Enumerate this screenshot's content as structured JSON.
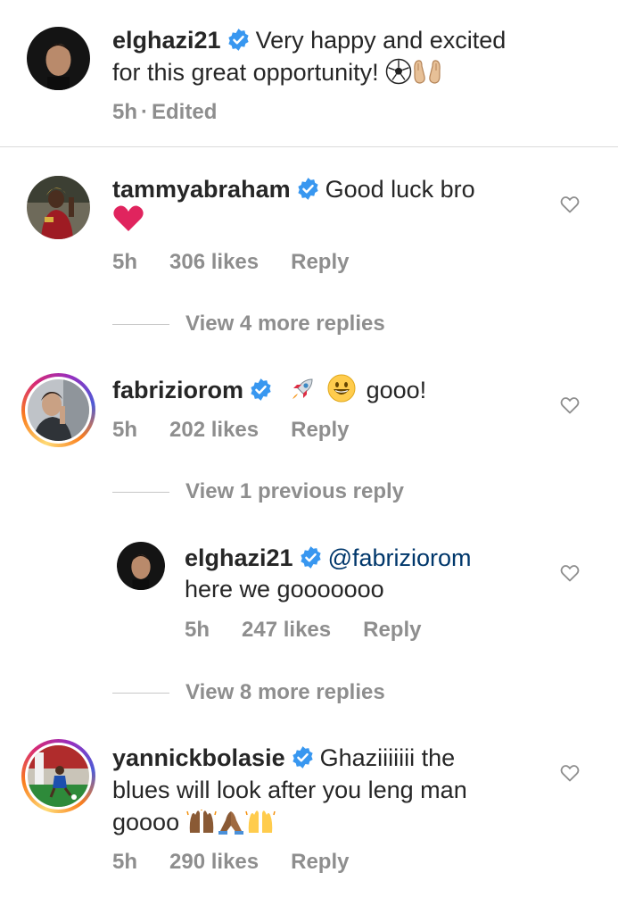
{
  "post": {
    "username": "elghazi21",
    "caption_line1": "Very happy and excited",
    "caption_line2": "for this great opportunity!",
    "time": "5h",
    "edited": "Edited",
    "separator": "·"
  },
  "comments": [
    {
      "username": "tammyabraham",
      "text": "Good luck bro",
      "time": "5h",
      "likes": "306 likes",
      "reply_label": "Reply",
      "view_replies": "View 4 more replies"
    },
    {
      "username": "fabriziorom",
      "text": "gooo!",
      "time": "5h",
      "likes": "202 likes",
      "reply_label": "Reply",
      "view_previous": "View 1 previous reply",
      "reply": {
        "username": "elghazi21",
        "mention": "@fabriziorom",
        "text": "here we gooooooo",
        "time": "5h",
        "likes": "247 likes",
        "reply_label": "Reply"
      },
      "view_replies": "View 8 more replies"
    },
    {
      "username": "yannickbolasie",
      "text_line1": "Ghaziiiiiii the",
      "text_line2": "blues will look after you leng man",
      "text_line3": "goooo",
      "time": "5h",
      "likes": "290 likes",
      "reply_label": "Reply"
    }
  ],
  "icons": {
    "verified": "verified-badge-icon",
    "heart": "heart-outline-icon",
    "emojis": [
      "soccer-ball",
      "palms-up-together",
      "red-heart",
      "rocket",
      "grinning-face",
      "raising-hands",
      "folded-hands"
    ]
  },
  "colors": {
    "text": "#262626",
    "secondary": "#8e8e8e",
    "verified": "#3897f0",
    "mention": "#00376b",
    "heart_red": "#e0245e"
  }
}
